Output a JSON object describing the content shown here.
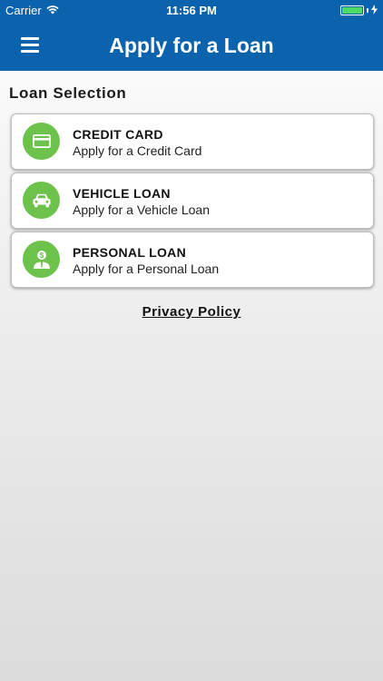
{
  "status_bar": {
    "carrier": "Carrier",
    "time": "11:56 PM",
    "battery_level": 1.0
  },
  "header": {
    "title": "Apply for a Loan",
    "menu_icon": "hamburger-menu-icon",
    "background_color": "#0c63ad"
  },
  "section": {
    "title": "Loan Selection"
  },
  "loans": [
    {
      "title": "CREDIT CARD",
      "subtitle": "Apply for a Credit Card",
      "icon": "credit-card-icon"
    },
    {
      "title": "VEHICLE LOAN",
      "subtitle": "Apply for a Vehicle Loan",
      "icon": "car-icon"
    },
    {
      "title": "PERSONAL LOAN",
      "subtitle": "Apply for a Personal Loan",
      "icon": "person-dollar-icon"
    }
  ],
  "colors": {
    "icon_background": "#6cc24a",
    "battery": "#4cd964"
  },
  "footer": {
    "privacy_link": "Privacy Policy"
  }
}
